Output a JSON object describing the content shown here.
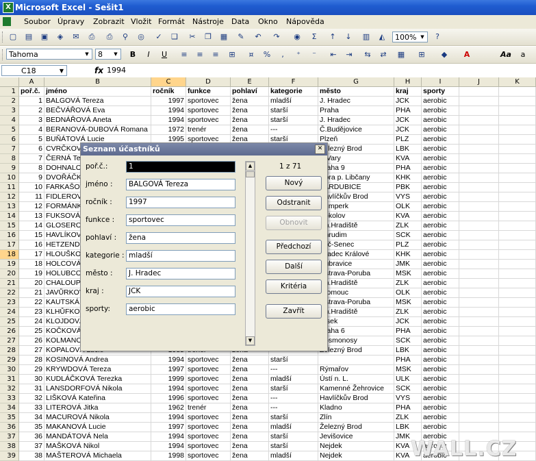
{
  "app": {
    "title": "Microsoft Excel - Sešit1"
  },
  "menu": [
    "Soubor",
    "Úpravy",
    "Zobrazit",
    "Vložit",
    "Formát",
    "Nástroje",
    "Data",
    "Okno",
    "Nápověda"
  ],
  "toolbar": {
    "zoom": "100%",
    "font": "Tahoma",
    "font_size": "8"
  },
  "formula_bar": {
    "cell_ref": "C18",
    "fx": "fx",
    "value": "1994"
  },
  "columns": [
    "A",
    "B",
    "C",
    "D",
    "E",
    "F",
    "G",
    "H",
    "I",
    "J",
    "K"
  ],
  "header": [
    "poř.č.",
    "jméno",
    "ročník",
    "funkce",
    "pohlaví",
    "kategorie",
    "město",
    "kraj",
    "sporty"
  ],
  "rows": [
    [
      "1",
      "BALGOVÁ Tereza",
      "1997",
      "sportovec",
      "žena",
      "mladší",
      "J. Hradec",
      "JCK",
      "aerobic"
    ],
    [
      "2",
      "BEČVÁŘOVÁ Eva",
      "1994",
      "sportovec",
      "žena",
      "starší",
      "Praha",
      "PHA",
      "aerobic"
    ],
    [
      "3",
      "BEDNÁŘOVÁ Aneta",
      "1994",
      "sportovec",
      "žena",
      "starší",
      "J. Hradec",
      "JCK",
      "aerobic"
    ],
    [
      "4",
      "BERANOVÁ-DUBOVÁ Romana",
      "1972",
      "trenér",
      "žena",
      "---",
      "Č.Budějovice",
      "JCK",
      "aerobic"
    ],
    [
      "5",
      "BUŇÁTOVÁ Lucie",
      "1995",
      "sportovec",
      "žena",
      "starší",
      "Plzeň",
      "PLZ",
      "aerobic"
    ],
    [
      "6",
      "CVRČKOVÁ",
      "",
      "",
      "",
      "",
      "Železný Brod",
      "LBK",
      "aerobic"
    ],
    [
      "7",
      "ČERNÁ Te",
      "",
      "",
      "",
      "",
      "K.Vary",
      "KVA",
      "aerobic"
    ],
    [
      "8",
      "DOHNALO",
      "",
      "",
      "",
      "",
      "Praha 9",
      "PHA",
      "aerobic"
    ],
    [
      "9",
      "DVOŘÁČK",
      "",
      "",
      "",
      "",
      "Hora p. Libčany",
      "KHK",
      "aerobic"
    ],
    [
      "10",
      "FARKAŠOV",
      "",
      "",
      "",
      "",
      "PARDUBICE",
      "PBK",
      "aerobic"
    ],
    [
      "11",
      "FIDLEROV",
      "",
      "",
      "",
      "",
      "Havlíčkův Brod",
      "VYS",
      "aerobic"
    ],
    [
      "12",
      "FORMÁNK",
      "",
      "",
      "",
      "",
      "Šumperk",
      "OLK",
      "aerobic"
    ],
    [
      "13",
      "FUKSOVÁ",
      "",
      "",
      "",
      "",
      "Sokolov",
      "KVA",
      "aerobic"
    ],
    [
      "14",
      "GLOSEROV",
      "",
      "",
      "",
      "",
      "Uh.Hradiště",
      "ZLK",
      "aerobic"
    ],
    [
      "15",
      "HAVLÍKOV",
      "",
      "",
      "",
      "",
      "Chrudim",
      "SCK",
      "aerobic"
    ],
    [
      "16",
      "HETZENDO",
      "",
      "",
      "",
      "",
      "Luč-Senec",
      "PLZ",
      "aerobic"
    ],
    [
      "17",
      "HLOUŠKOV",
      "",
      "",
      "",
      "",
      "Hradec Králové",
      "KHK",
      "aerobic"
    ],
    [
      "18",
      "HOLCOVÁ",
      "",
      "",
      "",
      "",
      "Dubravice",
      "JMK",
      "aerobic"
    ],
    [
      "19",
      "HOLUBCO",
      "",
      "",
      "",
      "",
      "Ostrava-Poruba",
      "MSK",
      "aerobic"
    ],
    [
      "20",
      "CHALOUP",
      "",
      "",
      "",
      "",
      "Uh.Hradiště",
      "ZLK",
      "aerobic"
    ],
    [
      "21",
      "JAVŮRKOV",
      "",
      "",
      "",
      "",
      "Olomouc",
      "OLK",
      "aerobic"
    ],
    [
      "22",
      "KAUTSKÁ",
      "",
      "",
      "",
      "",
      "Ostrava-Poruba",
      "MSK",
      "aerobic"
    ],
    [
      "23",
      "KLHŮFKOV",
      "",
      "",
      "",
      "",
      "Uh.Hradiště",
      "ZLK",
      "aerobic"
    ],
    [
      "24",
      "KLOJDOVÁ",
      "",
      "",
      "",
      "",
      "Písek",
      "JCK",
      "aerobic"
    ],
    [
      "25",
      "KOČKOVÁ",
      "",
      "",
      "",
      "",
      "Praha 6",
      "PHA",
      "aerobic"
    ],
    [
      "26",
      "KOLMANO",
      "",
      "",
      "",
      "",
      "Kosmonosy",
      "SCK",
      "aerobic"
    ],
    [
      "27",
      "KOPALOVÁ Lucie",
      "1985",
      "trenér",
      "žena",
      "",
      "Železný Brod",
      "LBK",
      "aerobic"
    ],
    [
      "28",
      "KOSINOVÁ Andrea",
      "1994",
      "sportovec",
      "žena",
      "starší",
      "",
      "PHA",
      "aerobic"
    ],
    [
      "29",
      "KRYWDOVÁ Tereza",
      "1997",
      "sportovec",
      "žena",
      "---",
      "Rýmařov",
      "MSK",
      "aerobic"
    ],
    [
      "30",
      "KUDLÁČKOVÁ Terezka",
      "1999",
      "sportovec",
      "žena",
      "mladší",
      "Ústí n. L.",
      "ULK",
      "aerobic"
    ],
    [
      "31",
      "LANSDORFOVÁ Nikola",
      "1994",
      "sportovec",
      "žena",
      "starší",
      "Kamenné Žehrovice",
      "SCK",
      "aerobic"
    ],
    [
      "32",
      "LIŠKOVÁ Kateřina",
      "1996",
      "sportovec",
      "žena",
      "---",
      "Havlíčkův Brod",
      "VYS",
      "aerobic"
    ],
    [
      "33",
      "LITEROVÁ Jitka",
      "1962",
      "trenér",
      "žena",
      "---",
      "Kladno",
      "PHA",
      "aerobic"
    ],
    [
      "34",
      "MACUROVÁ Nikola",
      "1994",
      "sportovec",
      "žena",
      "starší",
      "Zlín",
      "ZLK",
      "aerobic"
    ],
    [
      "35",
      "MAKANOVÁ Lucie",
      "1997",
      "sportovec",
      "žena",
      "mladší",
      "Železný Brod",
      "LBK",
      "aerobic"
    ],
    [
      "36",
      "MANDÁTOVÁ Nela",
      "1994",
      "sportovec",
      "žena",
      "starší",
      "Jevišovice",
      "JMK",
      "aerobic"
    ],
    [
      "37",
      "MAŠKOVÁ Nikol",
      "1994",
      "sportovec",
      "žena",
      "starší",
      "Nejdek",
      "KVA",
      "aerobic"
    ],
    [
      "38",
      "MAŠTEROVÁ Michaela",
      "1998",
      "sportovec",
      "žena",
      "mladší",
      "Nejdek",
      "KVA",
      "aerobic"
    ]
  ],
  "dialog": {
    "title": "Seznam účastníků",
    "counter": "1 z 71",
    "fields": [
      {
        "label": "poř.č.:",
        "value": "1"
      },
      {
        "label": "jméno :",
        "value": "BALGOVÁ Tereza"
      },
      {
        "label": "ročník :",
        "value": "1997"
      },
      {
        "label": "funkce :",
        "value": "sportovec"
      },
      {
        "label": "pohlaví :",
        "value": "žena"
      },
      {
        "label": "kategorie :",
        "value": "mladší"
      },
      {
        "label": "město :",
        "value": "J. Hradec"
      },
      {
        "label": "kraj :",
        "value": "JCK"
      },
      {
        "label": "sporty:",
        "value": "aerobic"
      }
    ],
    "buttons": [
      "Nový",
      "Odstranit",
      "Obnovit",
      "Předchozí",
      "Další",
      "Kritéria",
      "Zavřít"
    ]
  },
  "watermark": "WALL.CZ"
}
